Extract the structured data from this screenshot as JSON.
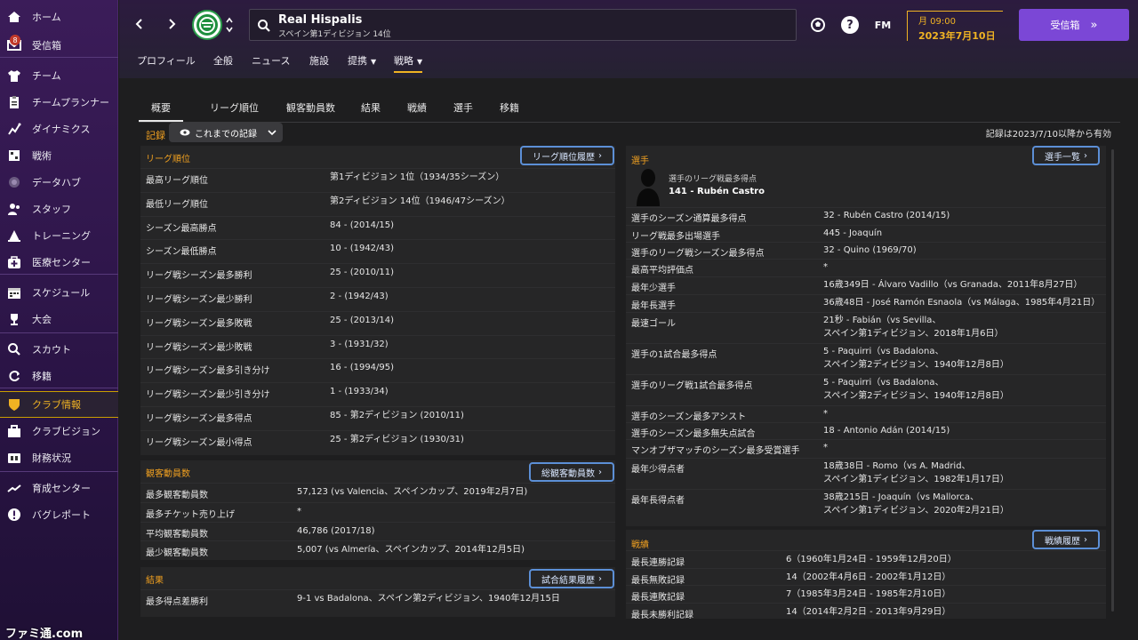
{
  "sidebar": {
    "badge_count": "8",
    "items": [
      {
        "label": "ホーム",
        "icon": "home-icon"
      },
      {
        "label": "受信箱",
        "icon": "inbox-icon"
      },
      {
        "label": "チーム",
        "icon": "shirt-icon"
      },
      {
        "label": "チームプランナー",
        "icon": "clipboard-icon"
      },
      {
        "label": "ダイナミクス",
        "icon": "dynamics-icon"
      },
      {
        "label": "戦術",
        "icon": "tactics-icon"
      },
      {
        "label": "データハブ",
        "icon": "data-hub-icon"
      },
      {
        "label": "スタッフ",
        "icon": "staff-icon"
      },
      {
        "label": "トレーニング",
        "icon": "training-icon"
      },
      {
        "label": "医療センター",
        "icon": "medical-icon"
      },
      {
        "label": "スケジュール",
        "icon": "calendar-icon"
      },
      {
        "label": "大会",
        "icon": "trophy-icon"
      },
      {
        "label": "スカウト",
        "icon": "search-icon"
      },
      {
        "label": "移籍",
        "icon": "transfer-icon"
      },
      {
        "label": "クラブ情報",
        "icon": "shield-icon"
      },
      {
        "label": "クラブビジョン",
        "icon": "briefcase-icon"
      },
      {
        "label": "財務状況",
        "icon": "finance-icon"
      },
      {
        "label": "育成センター",
        "icon": "youth-icon"
      },
      {
        "label": "バグレポート",
        "icon": "bug-report-icon"
      }
    ]
  },
  "header": {
    "club_name": "Real Hispalis",
    "club_sub": "スペイン第1ディビジョン 14位",
    "time": "月 09:00",
    "date": "2023年7月10日",
    "inbox_label": "受信箱",
    "fm_label": "FM",
    "tabs": [
      "プロフィール",
      "全般",
      "ニュース",
      "施設",
      "提携",
      "戦略"
    ]
  },
  "subtabs": [
    "概要",
    "リーグ順位",
    "観客動員数",
    "結果",
    "戦績",
    "選手",
    "移籍"
  ],
  "records_label": "記録",
  "filter_label": "これまでの記録",
  "valid_note": "記録は2023/7/10以降から有効",
  "league": {
    "title": "リーグ順位",
    "button": "リーグ順位履歴",
    "rows": [
      {
        "k": "最高リーグ順位",
        "v": "第1ディビジョン 1位（1934/35シーズン）"
      },
      {
        "k": "最低リーグ順位",
        "v": "第2ディビジョン 14位（1946/47シーズン）"
      },
      {
        "k": "シーズン最高勝点",
        "v": "84 - (2014/15)"
      },
      {
        "k": "シーズン最低勝点",
        "v": "10 - (1942/43)"
      },
      {
        "k": "リーグ戦シーズン最多勝利",
        "v": "25 - (2010/11)"
      },
      {
        "k": "リーグ戦シーズン最少勝利",
        "v": "2 - (1942/43)"
      },
      {
        "k": "リーグ戦シーズン最多敗戦",
        "v": "25 - (2013/14)"
      },
      {
        "k": "リーグ戦シーズン最少敗戦",
        "v": "3 - (1931/32)"
      },
      {
        "k": "リーグ戦シーズン最多引き分け",
        "v": "16 - (1994/95)"
      },
      {
        "k": "リーグ戦シーズン最少引き分け",
        "v": "1 - (1933/34)"
      },
      {
        "k": "リーグ戦シーズン最多得点",
        "v": "85 - 第2ディビジョン (2010/11)"
      },
      {
        "k": "リーグ戦シーズン最小得点",
        "v": "25 - 第2ディビジョン (1930/31)"
      }
    ]
  },
  "attendance": {
    "title": "観客動員数",
    "button": "総観客動員数",
    "rows": [
      {
        "k": "最多観客動員数",
        "v": "57,123 (vs Valencia、スペインカップ、2019年2月7日)"
      },
      {
        "k": "最多チケット売り上げ",
        "v": "*"
      },
      {
        "k": "平均観客動員数",
        "v": "46,786 (2017/18)"
      },
      {
        "k": "最少観客動員数",
        "v": "5,007 (vs Almería、スペインカップ、2014年12月5日)"
      }
    ]
  },
  "results": {
    "title": "結果",
    "button": "試合結果履歴",
    "rows": [
      {
        "k": "最多得点差勝利",
        "v": "9-1 vs Badalona、スペイン第2ディビジョン、1940年12月15日"
      }
    ]
  },
  "players": {
    "title": "選手",
    "button": "選手一覧",
    "feature_caption": "選手のリーグ戦最多得点",
    "feature_value": "141 - Rubén Castro",
    "rows": [
      {
        "k": "選手のシーズン通算最多得点",
        "v": [
          "32 - Rubén Castro (2014/15)"
        ]
      },
      {
        "k": "リーグ戦最多出場選手",
        "v": [
          "445 - Joaquín"
        ]
      },
      {
        "k": "選手のリーグ戦シーズン最多得点",
        "v": [
          "32 - Quino (1969/70)"
        ]
      },
      {
        "k": "最高平均評価点",
        "v": [
          "*"
        ]
      },
      {
        "k": "最年少選手",
        "v": [
          "16歳349日 - Álvaro Vadillo（vs Granada、2011年8月27日）"
        ]
      },
      {
        "k": "最年長選手",
        "v": [
          "36歳48日 - José Ramón Esnaola（vs Málaga、1985年4月21日）"
        ]
      },
      {
        "k": "最速ゴール",
        "v": [
          "21秒 - Fabián（vs Sevilla、",
          "スペイン第1ディビジョン、2018年1月6日）"
        ]
      },
      {
        "k": "選手の1試合最多得点",
        "v": [
          "5 - Paquirri（vs Badalona、",
          "スペイン第2ディビジョン、1940年12月8日）"
        ]
      },
      {
        "k": "選手のリーグ戦1試合最多得点",
        "v": [
          "5 - Paquirri（vs Badalona、",
          "スペイン第2ディビジョン、1940年12月8日）"
        ]
      },
      {
        "k": "選手のシーズン最多アシスト",
        "v": [
          "*"
        ]
      },
      {
        "k": "選手のシーズン最多無失点試合",
        "v": [
          "18 - Antonio Adán (2014/15)"
        ]
      },
      {
        "k": "マンオブザマッチのシーズン最多受賞選手",
        "v": [
          "*"
        ]
      },
      {
        "k": "最年少得点者",
        "v": [
          "18歳38日 - Romo（vs A. Madrid、",
          "スペイン第1ディビジョン、1982年1月17日）"
        ]
      },
      {
        "k": "最年長得点者",
        "v": [
          "38歳215日 - Joaquín（vs Mallorca、",
          "スペイン第1ディビジョン、2020年2月21日）"
        ]
      }
    ]
  },
  "form": {
    "title": "戦績",
    "button": "戦績履歴",
    "rows": [
      {
        "k": "最長連勝記録",
        "v": "6（1960年1月24日 - 1959年12月20日）"
      },
      {
        "k": "最長無敗記録",
        "v": "14（2002年4月6日 - 2002年1月12日）"
      },
      {
        "k": "最長連敗記録",
        "v": "7（1985年3月24日 - 1985年2月10日）"
      },
      {
        "k": "最長未勝利記録",
        "v": "14（2014年2月2日 - 2013年9月29日）"
      }
    ]
  },
  "watermark": "ファミ通.com"
}
